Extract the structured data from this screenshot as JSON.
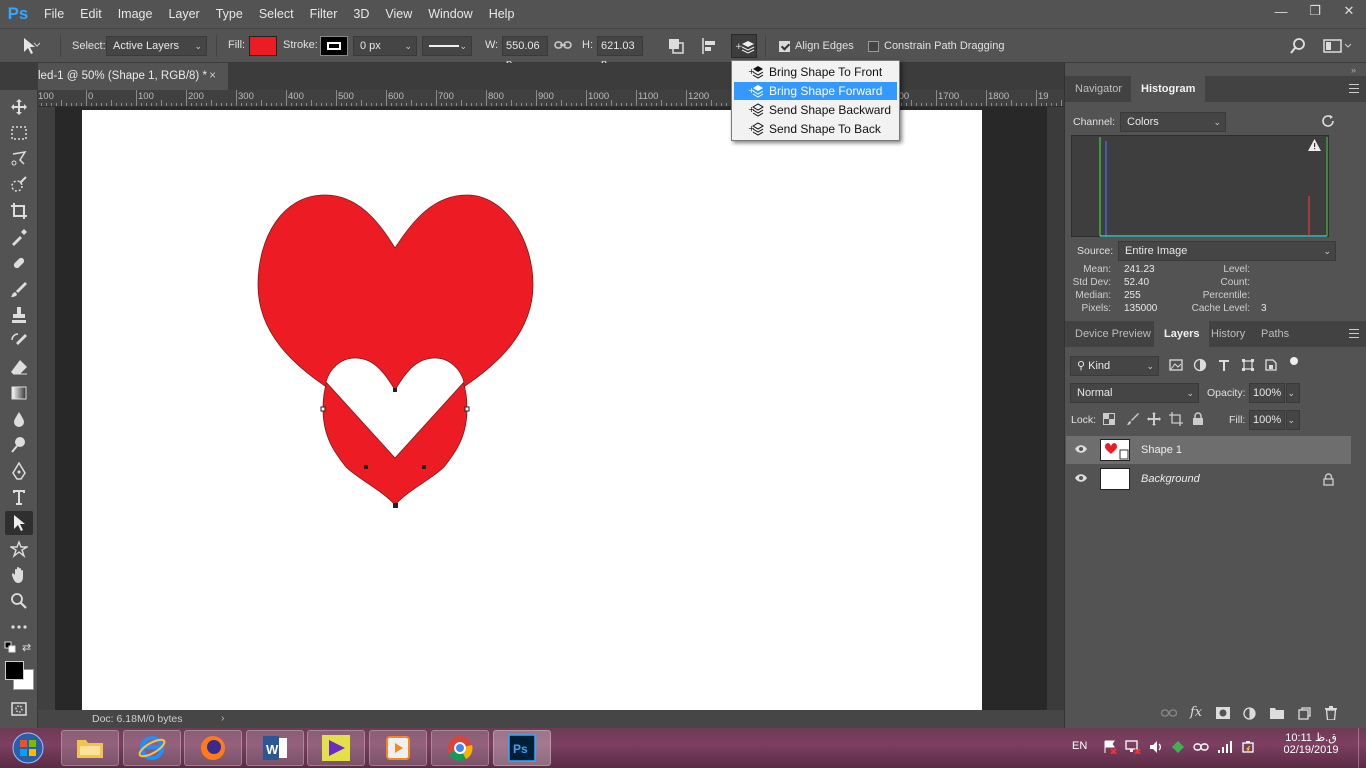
{
  "app": {
    "logo": "Ps"
  },
  "menu": [
    "File",
    "Edit",
    "Image",
    "Layer",
    "Type",
    "Select",
    "Filter",
    "3D",
    "View",
    "Window",
    "Help"
  ],
  "window_controls": {
    "minimize": "—",
    "restore": "❐",
    "close": "✕"
  },
  "options": {
    "select_label": "Select:",
    "select_value": "Active Layers",
    "fill_label": "Fill:",
    "fill_color": "#ed1c24",
    "stroke_label": "Stroke:",
    "stroke_width": "0 px",
    "w_label": "W:",
    "w_value": "550.06 p",
    "h_label": "H:",
    "h_value": "621.03 p",
    "align_edges_label": "Align Edges",
    "align_edges_checked": true,
    "constrain_label": "Constrain Path Dragging",
    "constrain_checked": false
  },
  "document": {
    "tab_title": "led-1 @ 50% (Shape 1, RGB/8) *",
    "tab_close": "×",
    "status": "Doc: 6.18M/0 bytes"
  },
  "ruler_h": [
    "100",
    "0",
    "100",
    "200",
    "300",
    "400",
    "500",
    "600",
    "700",
    "800",
    "900",
    "1000",
    "1100",
    "1200",
    "1300",
    "1400",
    "1500",
    "1600",
    "1700",
    "1800",
    "19"
  ],
  "arrange_menu": {
    "items": [
      "Bring Shape To Front",
      "Bring Shape Forward",
      "Send Shape Backward",
      "Send Shape To Back"
    ],
    "highlighted_index": 1
  },
  "histogram_panel": {
    "tabs": [
      "Navigator",
      "Histogram"
    ],
    "active_tab": "Histogram",
    "channel_label": "Channel:",
    "channel_value": "Colors",
    "source_label": "Source:",
    "source_value": "Entire Image",
    "stats_left": [
      {
        "label": "Mean:",
        "value": "241.23"
      },
      {
        "label": "Std Dev:",
        "value": "52.40"
      },
      {
        "label": "Median:",
        "value": "255"
      },
      {
        "label": "Pixels:",
        "value": "135000"
      }
    ],
    "stats_right": [
      {
        "label": "Level:",
        "value": ""
      },
      {
        "label": "Count:",
        "value": ""
      },
      {
        "label": "Percentile:",
        "value": ""
      },
      {
        "label": "Cache Level:",
        "value": "3"
      }
    ]
  },
  "layers_panel": {
    "tabs": [
      "Device Preview",
      "Layers",
      "History",
      "Paths"
    ],
    "active_tab": "Layers",
    "kind_label": "Kind",
    "blend_mode": "Normal",
    "opacity_label": "Opacity:",
    "opacity_value": "100%",
    "lock_label": "Lock:",
    "fill_label": "Fill:",
    "fill_value": "100%",
    "layers": [
      {
        "name": "Shape 1",
        "selected": true,
        "locked": false
      },
      {
        "name": "Background",
        "selected": false,
        "locked": true
      }
    ]
  },
  "taskbar": {
    "language": "EN",
    "time": "10:11 ق.ظ",
    "date": "02/19/2019"
  }
}
